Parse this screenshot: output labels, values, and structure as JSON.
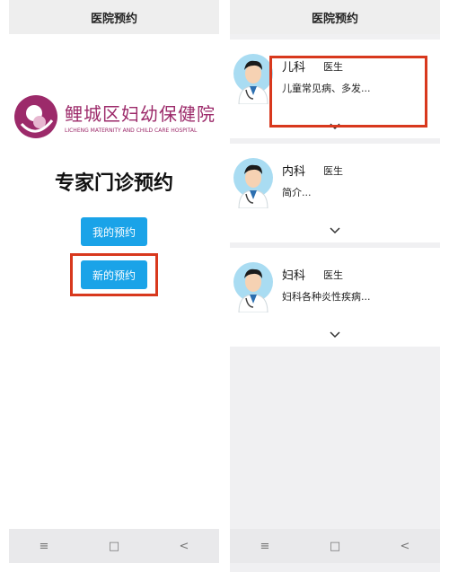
{
  "left_screen": {
    "title": "医院预约",
    "logo": {
      "name_cn": "鲤城区妇幼保健院",
      "name_en": "LICHENG MATERNITY AND CHILD CARE HOSPITAL"
    },
    "heading": "专家门诊预约",
    "buttons": {
      "my_appointments": "我的预约",
      "new_appointment": "新的预约"
    },
    "nav": {
      "menu": "≡",
      "home": "□",
      "back": "<"
    }
  },
  "right_screen": {
    "title": "医院预约",
    "departments": [
      {
        "name": "儿科",
        "role": "医生",
        "description": "儿童常见病、多发..."
      },
      {
        "name": "内科",
        "role": "医生",
        "description": "简介..."
      },
      {
        "name": "妇科",
        "role": "医生",
        "description": "妇科各种炎性疾病..."
      }
    ],
    "nav": {
      "menu": "≡",
      "home": "□",
      "back": "<"
    }
  },
  "colors": {
    "accent_blue": "#1aa3e8",
    "highlight_red": "#d8381d",
    "logo_purple": "#9c2a6a"
  }
}
